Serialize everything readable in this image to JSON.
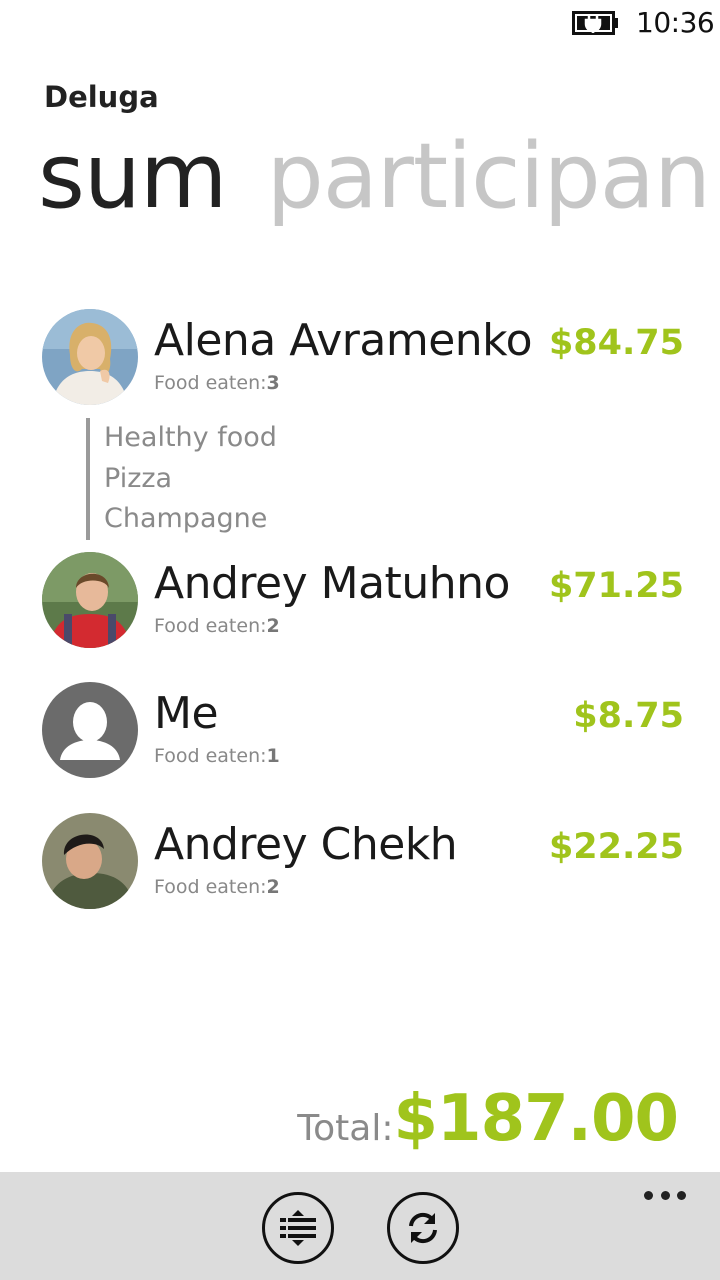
{
  "status_bar": {
    "time": "10:36",
    "battery_icon": "battery-charging-icon"
  },
  "app_title": "Deluga",
  "pivot": {
    "active": "sum",
    "next": "participan"
  },
  "participants": [
    {
      "name": "Alena Avramenko",
      "food_label": "Food eaten:",
      "food_count": "3",
      "amount": "$84.75",
      "avatar": "avatar-photo-alena"
    },
    {
      "name": "Andrey Matuhno",
      "food_label": "Food eaten:",
      "food_count": "2",
      "amount": "$71.25",
      "avatar": "avatar-photo-andrey-m"
    },
    {
      "name": "Me",
      "food_label": "Food eaten:",
      "food_count": "1",
      "amount": "$8.75",
      "avatar": "default-person-icon"
    },
    {
      "name": "Andrey Chekh",
      "food_label": "Food eaten:",
      "food_count": "2",
      "amount": "$22.25",
      "avatar": "avatar-photo-andrey-c"
    }
  ],
  "expanded_food": [
    "Healthy food",
    "Pizza",
    "Champagne"
  ],
  "total": {
    "label": "Total:",
    "value": "$187.00"
  },
  "app_bar": {
    "buttons": [
      "split-list-icon",
      "refresh-icon"
    ],
    "more": "more-options-icon"
  },
  "colors": {
    "accent": "#a0c41c",
    "app_bar_bg": "#dcdcdc"
  }
}
